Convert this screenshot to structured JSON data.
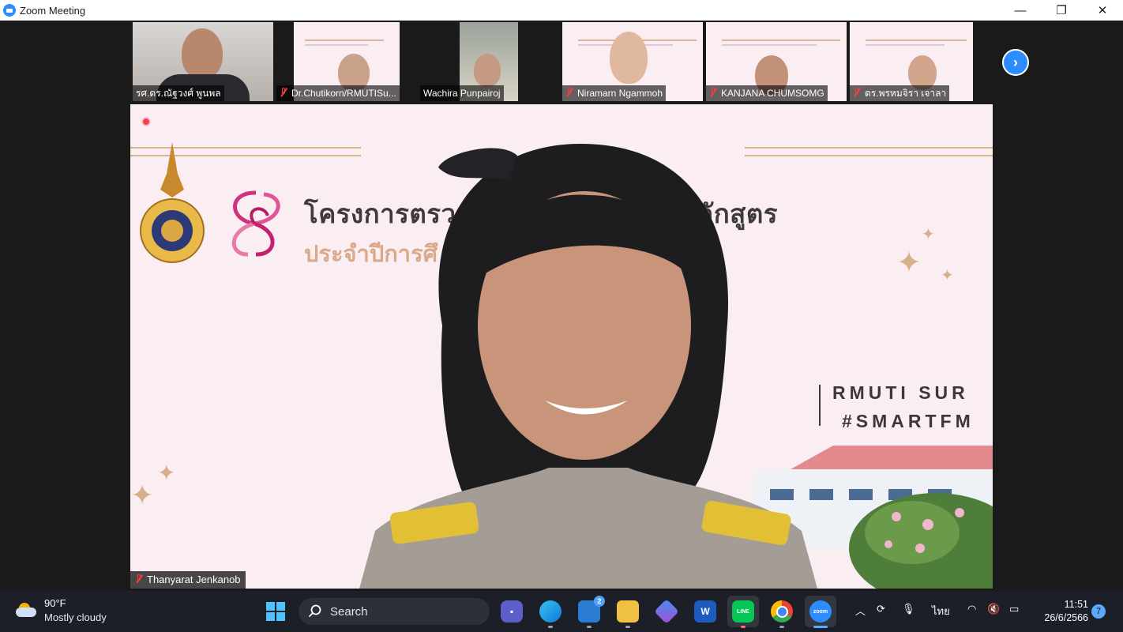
{
  "window": {
    "title": "Zoom Meeting"
  },
  "window_controls": {
    "minimize": "—",
    "restore": "❐",
    "close": "✕"
  },
  "participants": [
    {
      "name": "รศ.ดร.ณัฐวงศ์ พูนพล",
      "muted": false
    },
    {
      "name": "Dr.Chutikorn/RMUTISu...",
      "muted": true
    },
    {
      "name": "Wachira Punpairoj",
      "muted": false
    },
    {
      "name": "Niramarn Ngammoh",
      "muted": true
    },
    {
      "name": "KANJANA CHUMSOMG",
      "muted": true
    },
    {
      "name": "ดร.พรหมจิรา เจาลา",
      "muted": true
    }
  ],
  "next_page_icon": "chevron-right-icon",
  "main_speaker": {
    "name": "Thanyarat Jenkanob",
    "muted": true,
    "slide": {
      "headline": "โครงการตรว                         ศึกษาภายใน ระดับหลักสูตร",
      "subline": "ประจำปีการศึ                                   ยีการจัดการ",
      "brand_line1": "RMUTI SUR",
      "brand_line2": "#SMARTFM"
    }
  },
  "taskbar": {
    "weather_temp": "90°F",
    "weather_desc": "Mostly cloudy",
    "search_label": "Search",
    "mail_badge": "2",
    "word_label": "W",
    "line_label": "LINE",
    "zoom_label": "zoom",
    "language": "ไทย",
    "time": "11:51",
    "date": "26/6/2566",
    "notification_count": "7"
  },
  "colors": {
    "zoom_blue": "#2d8cff",
    "slide_bg": "#fbeef3",
    "accent_gold": "#d6b08a",
    "taskbar_bg": "#1c1f27"
  }
}
